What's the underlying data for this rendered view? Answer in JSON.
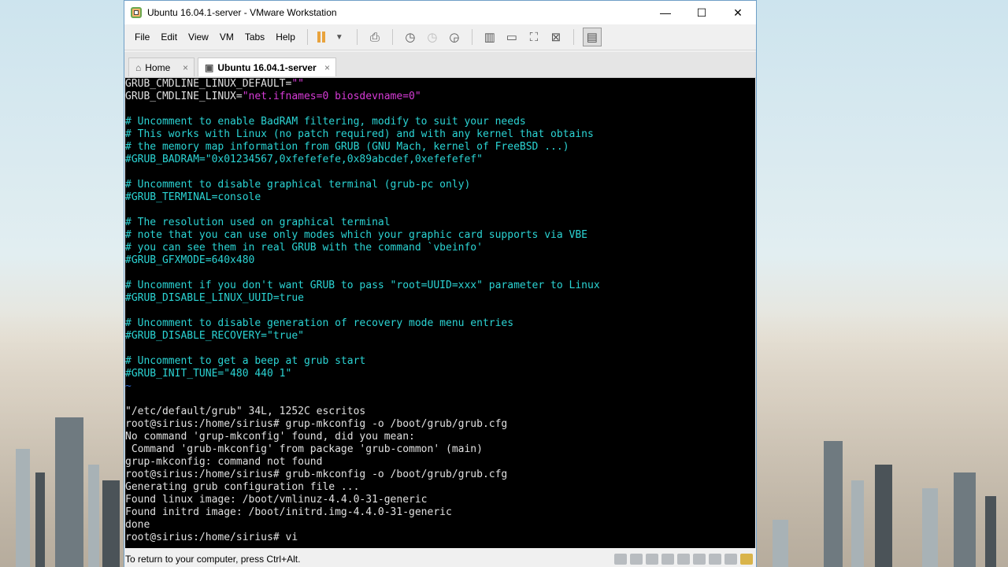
{
  "window": {
    "title": "Ubuntu 16.04.1-server - VMware Workstation",
    "controls": {
      "minimize": "—",
      "maximize": "☐",
      "close": "✕"
    }
  },
  "menubar": {
    "items": [
      "File",
      "Edit",
      "View",
      "VM",
      "Tabs",
      "Help"
    ]
  },
  "tabs": [
    {
      "label": "Home",
      "active": false,
      "close": "×"
    },
    {
      "label": "Ubuntu 16.04.1-server",
      "active": true,
      "close": "×"
    }
  ],
  "console": {
    "lines": [
      {
        "segments": [
          {
            "t": "GRUB_CMDLINE_LINUX_DEFAULT=",
            "c": "var"
          },
          {
            "t": "\"\"",
            "c": "mag"
          }
        ]
      },
      {
        "segments": [
          {
            "t": "GRUB_CMDLINE_LINUX=",
            "c": "var"
          },
          {
            "t": "\"net.ifnames=0 biosdevname=0\"",
            "c": "mag"
          }
        ]
      },
      {
        "segments": []
      },
      {
        "segments": [
          {
            "t": "# Uncomment to enable BadRAM filtering, modify to suit your needs",
            "c": "cmt"
          }
        ]
      },
      {
        "segments": [
          {
            "t": "# This works with Linux (no patch required) and with any kernel that obtains",
            "c": "cmt"
          }
        ]
      },
      {
        "segments": [
          {
            "t": "# the memory map information from GRUB (GNU Mach, kernel of FreeBSD ...)",
            "c": "cmt"
          }
        ]
      },
      {
        "segments": [
          {
            "t": "#GRUB_BADRAM=\"0x01234567,0xfefefefe,0x89abcdef,0xefefefef\"",
            "c": "cmt"
          }
        ]
      },
      {
        "segments": []
      },
      {
        "segments": [
          {
            "t": "# Uncomment to disable graphical terminal (grub-pc only)",
            "c": "cmt"
          }
        ]
      },
      {
        "segments": [
          {
            "t": "#GRUB_TERMINAL=console",
            "c": "cmt"
          }
        ]
      },
      {
        "segments": []
      },
      {
        "segments": [
          {
            "t": "# The resolution used on graphical terminal",
            "c": "cmt"
          }
        ]
      },
      {
        "segments": [
          {
            "t": "# note that you can use only modes which your graphic card supports via VBE",
            "c": "cmt"
          }
        ]
      },
      {
        "segments": [
          {
            "t": "# you can see them in real GRUB with the command `vbeinfo'",
            "c": "cmt"
          }
        ]
      },
      {
        "segments": [
          {
            "t": "#GRUB_GFXMODE=640x480",
            "c": "cmt"
          }
        ]
      },
      {
        "segments": []
      },
      {
        "segments": [
          {
            "t": "# Uncomment if you don't want GRUB to pass \"root=UUID=xxx\" parameter to Linux",
            "c": "cmt"
          }
        ]
      },
      {
        "segments": [
          {
            "t": "#GRUB_DISABLE_LINUX_UUID=true",
            "c": "cmt"
          }
        ]
      },
      {
        "segments": []
      },
      {
        "segments": [
          {
            "t": "# Uncomment to disable generation of recovery mode menu entries",
            "c": "cmt"
          }
        ]
      },
      {
        "segments": [
          {
            "t": "#GRUB_DISABLE_RECOVERY=\"true\"",
            "c": "cmt"
          }
        ]
      },
      {
        "segments": []
      },
      {
        "segments": [
          {
            "t": "# Uncomment to get a beep at grub start",
            "c": "cmt"
          }
        ]
      },
      {
        "segments": [
          {
            "t": "#GRUB_INIT_TUNE=\"480 440 1\"",
            "c": "cmt"
          }
        ]
      },
      {
        "segments": [
          {
            "t": "~",
            "c": "tilde"
          }
        ]
      },
      {
        "segments": []
      },
      {
        "segments": [
          {
            "t": "\"/etc/default/grub\" 34L, 1252C escritos",
            "c": "var"
          }
        ]
      },
      {
        "segments": [
          {
            "t": "root@sirius:/home/sirius# grup-mkconfig -o /boot/grub/grub.cfg",
            "c": "var"
          }
        ]
      },
      {
        "segments": [
          {
            "t": "No command 'grup-mkconfig' found, did you mean:",
            "c": "var"
          }
        ]
      },
      {
        "segments": [
          {
            "t": " Command 'grub-mkconfig' from package 'grub-common' (main)",
            "c": "var"
          }
        ]
      },
      {
        "segments": [
          {
            "t": "grup-mkconfig: command not found",
            "c": "var"
          }
        ]
      },
      {
        "segments": [
          {
            "t": "root@sirius:/home/sirius# grub-mkconfig -o /boot/grub/grub.cfg",
            "c": "var"
          }
        ]
      },
      {
        "segments": [
          {
            "t": "Generating grub configuration file ...",
            "c": "var"
          }
        ]
      },
      {
        "segments": [
          {
            "t": "Found linux image: /boot/vmlinuz-4.4.0-31-generic",
            "c": "var"
          }
        ]
      },
      {
        "segments": [
          {
            "t": "Found initrd image: /boot/initrd.img-4.4.0-31-generic",
            "c": "var"
          }
        ]
      },
      {
        "segments": [
          {
            "t": "done",
            "c": "var"
          }
        ]
      },
      {
        "segments": [
          {
            "t": "root@sirius:/home/sirius# vi",
            "c": "var"
          }
        ]
      }
    ]
  },
  "statusbar": {
    "text": "To return to your computer, press Ctrl+Alt."
  },
  "colors": {
    "comment": "#2bd4d4",
    "string": "#d63bd6",
    "text": "#e0e0e0",
    "console_bg": "#000000"
  }
}
